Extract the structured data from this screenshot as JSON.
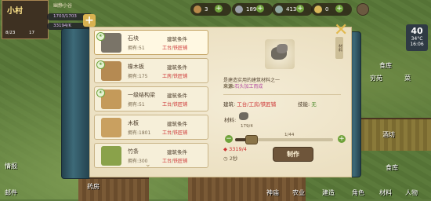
{
  "topbar": {
    "village_name": "小村",
    "village_sub": "幽静小谷",
    "res_pop": "1703/1703",
    "res_money": "33194/K",
    "pop_count": "8/23",
    "pop_count2": "17",
    "plus_label": "+",
    "stat1": "3",
    "stat2": "189",
    "stat3": "413",
    "stat4": "0"
  },
  "clock": {
    "day": "40",
    "temp": "34°C",
    "time": "16:06"
  },
  "right_labels": [
    "食库",
    "酒坊",
    "菜",
    "穷苑",
    "食库"
  ],
  "left_labels": [
    "情报",
    "邮件"
  ],
  "bottom_labels": [
    "药房",
    "神庙",
    "农业",
    "建造",
    "角色",
    "材料",
    "人物"
  ],
  "items": [
    {
      "lvl": "④",
      "name": "石块",
      "own_label": "拥有:",
      "own": "51",
      "cond_label": "建筑条件",
      "req_a": "工台",
      "req_b": "铁匠铺",
      "color": "#7a7468"
    },
    {
      "lvl": "⑥",
      "name": "橡木板",
      "own_label": "拥有:",
      "own": "175",
      "cond_label": "建筑条件",
      "req_a": "工房",
      "req_b": "铁匠铺",
      "color": "#b58a52"
    },
    {
      "lvl": "④",
      "name": "一级结构梁",
      "own_label": "拥有:",
      "own": "51",
      "cond_label": "建筑条件",
      "req_a": "工台",
      "req_b": "铁匠铺",
      "color": "#c49a5a"
    },
    {
      "lvl": "",
      "name": "木板",
      "own_label": "拥有:",
      "own": "1801",
      "cond_label": "建筑条件",
      "req_a": "工台",
      "req_b": "铁匠铺",
      "color": "#c9a060"
    },
    {
      "lvl": "",
      "name": "竹条",
      "own_label": "拥有:",
      "own": "300",
      "cond_label": "建筑条件",
      "req_a": "工台",
      "req_b": "铁匠铺",
      "color": "#8aa24a"
    }
  ],
  "detail": {
    "desc": "是建造实用的建筑材料之一",
    "source_label": "来源:",
    "source_value": "石头加工而成",
    "bld_label": "建筑:",
    "bld_value": "工台/工房/铁匠铺",
    "skill_label": "技能:",
    "skill_value": "无",
    "mat_label": "材料:",
    "mat_qty": "179/4",
    "count": "1/44",
    "cost": "3319/4",
    "time": "2秒",
    "make_label": "制作",
    "side_tab": "材料",
    "chevron": "⌄"
  }
}
